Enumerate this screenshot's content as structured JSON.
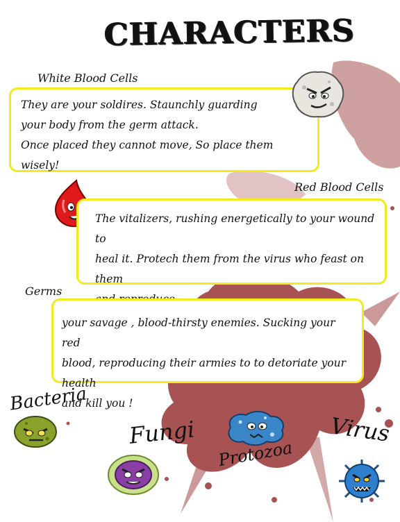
{
  "title": "CHARACTERS",
  "white_blood_cells": {
    "label": "White Blood Cells",
    "lines": [
      "They are your soldires. Staunchly guarding",
      "your body from the germ attack.",
      "Once placed they cannot move, So place them wisely!"
    ]
  },
  "red_blood_cells": {
    "label": "Red Blood Cells",
    "lines": [
      "The vitalizers, rushing energetically to your wound to",
      "heal it.  Protech them from the virus who feast on them",
      "and reproduce ."
    ]
  },
  "germs": {
    "label": "Germs",
    "lines": [
      "your savage , blood-thirsty enemies. Sucking your red",
      "blood, reproducing their armies to to detoriate your health",
      "and kill you !"
    ],
    "types": {
      "bacteria": "Bacteria",
      "fungi": "Fungi",
      "protozoa": "Protozoa",
      "virus": "Virus"
    }
  },
  "colors": {
    "box_border": "#f3ea1e",
    "blood": "#8b1a1a"
  },
  "icons": [
    "white-blood-cell-icon",
    "red-blood-cell-icon",
    "bacteria-icon",
    "fungi-icon",
    "protozoa-icon",
    "virus-icon"
  ]
}
